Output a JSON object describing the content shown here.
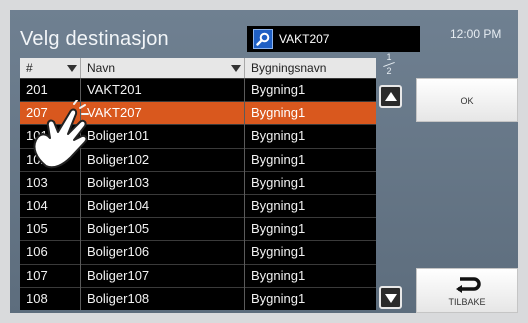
{
  "screen": {
    "title": "Velg destinasjon",
    "time": "12:00 PM",
    "search": {
      "icon": "search-icon",
      "value": "VAKT207"
    },
    "page_indicator": {
      "current": "1",
      "total": "2"
    }
  },
  "table": {
    "columns": [
      {
        "label": "#",
        "sortable": true
      },
      {
        "label": "Navn",
        "sortable": true
      },
      {
        "label": "Bygningsnavn",
        "sortable": false
      }
    ],
    "rows": [
      {
        "num": "201",
        "name": "VAKT201",
        "building": "Bygning1",
        "selected": false
      },
      {
        "num": "207",
        "name": "VAKT207",
        "building": "Bygning1",
        "selected": true
      },
      {
        "num": "101",
        "name": "Boliger101",
        "building": "Bygning1",
        "selected": false
      },
      {
        "num": "102",
        "name": "Boliger102",
        "building": "Bygning1",
        "selected": false
      },
      {
        "num": "103",
        "name": "Boliger103",
        "building": "Bygning1",
        "selected": false
      },
      {
        "num": "104",
        "name": "Boliger104",
        "building": "Bygning1",
        "selected": false
      },
      {
        "num": "105",
        "name": "Boliger105",
        "building": "Bygning1",
        "selected": false
      },
      {
        "num": "106",
        "name": "Boliger106",
        "building": "Bygning1",
        "selected": false
      },
      {
        "num": "107",
        "name": "Boliger107",
        "building": "Bygning1",
        "selected": false
      },
      {
        "num": "108",
        "name": "Boliger108",
        "building": "Bygning1",
        "selected": false
      }
    ]
  },
  "buttons": {
    "ok": "OK",
    "back": {
      "label": "TILBAKE",
      "icon": "return-arrow-icon"
    },
    "scroll_up_icon": "triangle-up-icon",
    "scroll_down_icon": "triangle-down-icon"
  },
  "colors": {
    "selected_row": "#d9581e",
    "screen_bg": "#5d6d7d",
    "search_icon_bg": "#1f5fc4"
  },
  "overlay": {
    "icon": "tapping-hand-icon"
  }
}
